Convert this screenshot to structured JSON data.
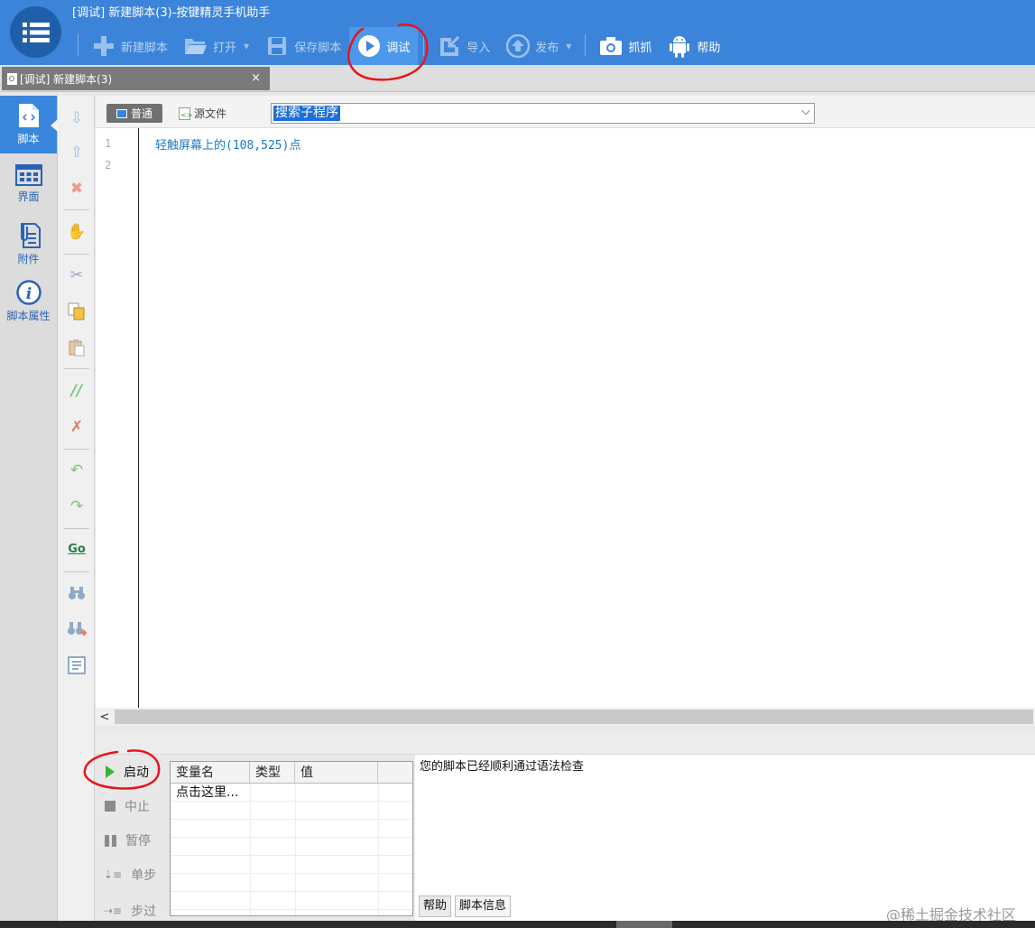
{
  "window": {
    "title": "[调试] 新建脚本(3)-按键精灵手机助手"
  },
  "toolbar": {
    "new_script": "新建脚本",
    "open": "打开",
    "save_script": "保存脚本",
    "debug": "调试",
    "import": "导入",
    "publish": "发布",
    "capture": "抓抓",
    "help": "帮助"
  },
  "document_tab": {
    "label": "[调试]  新建脚本(3)",
    "close": "×"
  },
  "leftnav": {
    "items": [
      {
        "label": "脚本",
        "icon": "script-file-icon",
        "active": true
      },
      {
        "label": "界面",
        "icon": "ui-grid-icon",
        "active": false
      },
      {
        "label": "附件",
        "icon": "attachment-icon",
        "active": false
      },
      {
        "label": "脚本属性",
        "icon": "info-icon",
        "active": false
      }
    ]
  },
  "editor": {
    "mode_normal": "普通",
    "mode_source": "源文件",
    "subroutine_search": "搜索子程序",
    "line_numbers": [
      "1",
      "2"
    ],
    "code": "轻触屏幕上的(108,525)点",
    "scroll_left": "<"
  },
  "debug": {
    "start": "启动",
    "stop": "中止",
    "pause": "暂停",
    "step": "单步",
    "step_over": "步过",
    "var_columns": [
      "变量名",
      "类型",
      "值"
    ],
    "var_placeholder": "点击这里...",
    "output_message": "您的脚本已经顺利通过语法检查",
    "output_tabs": [
      "帮助",
      "脚本信息"
    ]
  },
  "watermark": "@稀土掘金技术社区",
  "colors": {
    "header_blue": "#3c84d9",
    "active_blue": "#4e98ec",
    "code_blue": "#1a78c8",
    "annotation_red": "#e8141b"
  }
}
